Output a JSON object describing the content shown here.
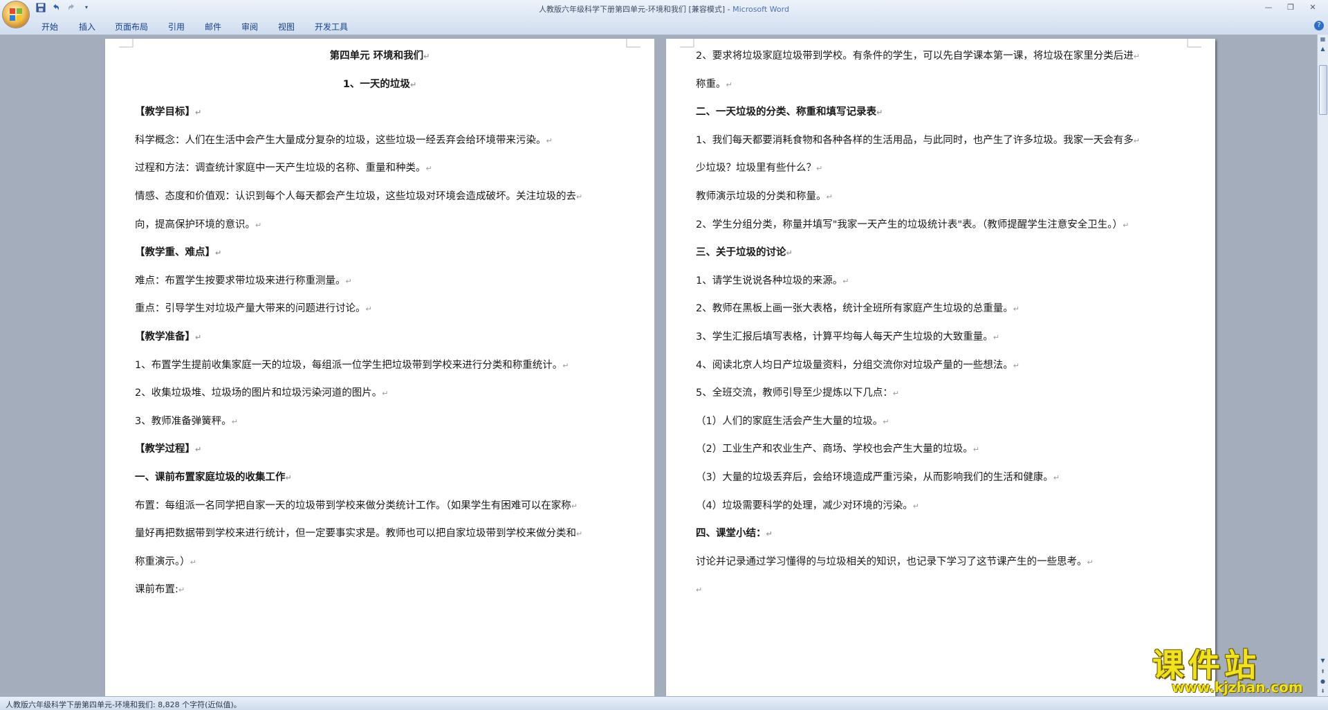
{
  "window": {
    "doc_title": "人教版六年级科学下册第四单元-环境和我们 [兼容模式]",
    "separator": " - ",
    "app_name": "Microsoft Word"
  },
  "ribbon": {
    "tabs": [
      "开始",
      "插入",
      "页面布局",
      "引用",
      "邮件",
      "审阅",
      "视图",
      "开发工具"
    ]
  },
  "page1": {
    "lines": [
      {
        "text": "第四单元  环境和我们",
        "bold": true,
        "center": true
      },
      {
        "text": "1、一天的垃圾",
        "bold": true,
        "center": true
      },
      {
        "text": "【教学目标】",
        "bold": true
      },
      {
        "text": "科学概念：人们在生活中会产生大量成分复杂的垃圾，这些垃圾一经丢弃会给环境带来污染。"
      },
      {
        "text": "过程和方法：调查统计家庭中一天产生垃圾的名称、重量和种类。"
      },
      {
        "text": "情感、态度和价值观：认识到每个人每天都会产生垃圾，这些垃圾对环境会造成破坏。关注垃圾的去"
      },
      {
        "text": "向，提高保护环境的意识。"
      },
      {
        "text": "【教学重、难点】",
        "bold": true
      },
      {
        "text": "难点：布置学生按要求带垃圾来进行称重测量。"
      },
      {
        "text": "重点：引导学生对垃圾产量大带来的问题进行讨论。"
      },
      {
        "text": "【教学准备】",
        "bold": true
      },
      {
        "text": "1、布置学生提前收集家庭一天的垃圾，每组派一位学生把垃圾带到学校来进行分类和称重统计。"
      },
      {
        "text": "2、收集垃圾堆、垃圾场的图片和垃圾污染河道的图片。"
      },
      {
        "text": "3、教师准备弹簧秤。"
      },
      {
        "text": "【教学过程】",
        "bold": true
      },
      {
        "text": "一、课前布置家庭垃圾的收集工作",
        "bold": true
      },
      {
        "text": "布置：每组派一名同学把自家一天的垃圾带到学校来做分类统计工作。（如果学生有困难可以在家称"
      },
      {
        "text": "量好再把数据带到学校来进行统计，但一定要事实求是。教师也可以把自家垃圾带到学校来做分类和"
      },
      {
        "text": "称重演示。）"
      },
      {
        "text": "课前布置:"
      }
    ]
  },
  "page2": {
    "lines": [
      {
        "text": "2、要求将垃圾家庭垃圾带到学校。有条件的学生，可以先自学课本第一课，将垃圾在家里分类后进"
      },
      {
        "text": "称重。"
      },
      {
        "text": "二、一天垃圾的分类、称重和填写记录表",
        "bold": true
      },
      {
        "text": "1、我们每天都要消耗食物和各种各样的生活用品，与此同时，也产生了许多垃圾。我家一天会有多"
      },
      {
        "text": "少垃圾？垃圾里有些什么？"
      },
      {
        "text": "教师演示垃圾的分类和称量。"
      },
      {
        "text": "2、学生分组分类，称量并填写\"我家一天产生的垃圾统计表\"表。（教师提醒学生注意安全卫生。）"
      },
      {
        "text": "三、关于垃圾的讨论",
        "bold": true
      },
      {
        "text": "1、请学生说说各种垃圾的来源。"
      },
      {
        "text": "2、教师在黑板上画一张大表格，统计全班所有家庭产生垃圾的总重量。"
      },
      {
        "text": "3、学生汇报后填写表格，计算平均每人每天产生垃圾的大致重量。"
      },
      {
        "text": "4、阅读北京人均日产垃圾量资料，分组交流你对垃圾产量的一些想法。"
      },
      {
        "text": "5、全班交流，教师引导至少提炼以下几点："
      },
      {
        "text": "（1）人们的家庭生活会产生大量的垃圾。"
      },
      {
        "text": "（2）工业生产和农业生产、商场、学校也会产生大量的垃圾。"
      },
      {
        "text": "（3）大量的垃圾丢弃后，会给环境造成严重污染，从而影响我们的生活和健康。"
      },
      {
        "text": "（4）垃圾需要科学的处理，减少对环境的污染。"
      },
      {
        "text": "四、课堂小结：",
        "bold": true
      },
      {
        "text": "讨论并记录通过学习懂得的与垃圾相关的知识，也记录下学习了这节课产生的一些思考。"
      },
      {
        "text": ""
      }
    ]
  },
  "status": {
    "text": "人教版六年级科学下册第四单元-环境和我们: 8,828 个字符(近似值)。"
  },
  "watermark": {
    "title": "课件站",
    "url": "www.kjzhan.com"
  },
  "colors": {
    "app_name": "#4a73b8",
    "ribbon_text": "#15428b",
    "watermark": "#f2e21a"
  }
}
